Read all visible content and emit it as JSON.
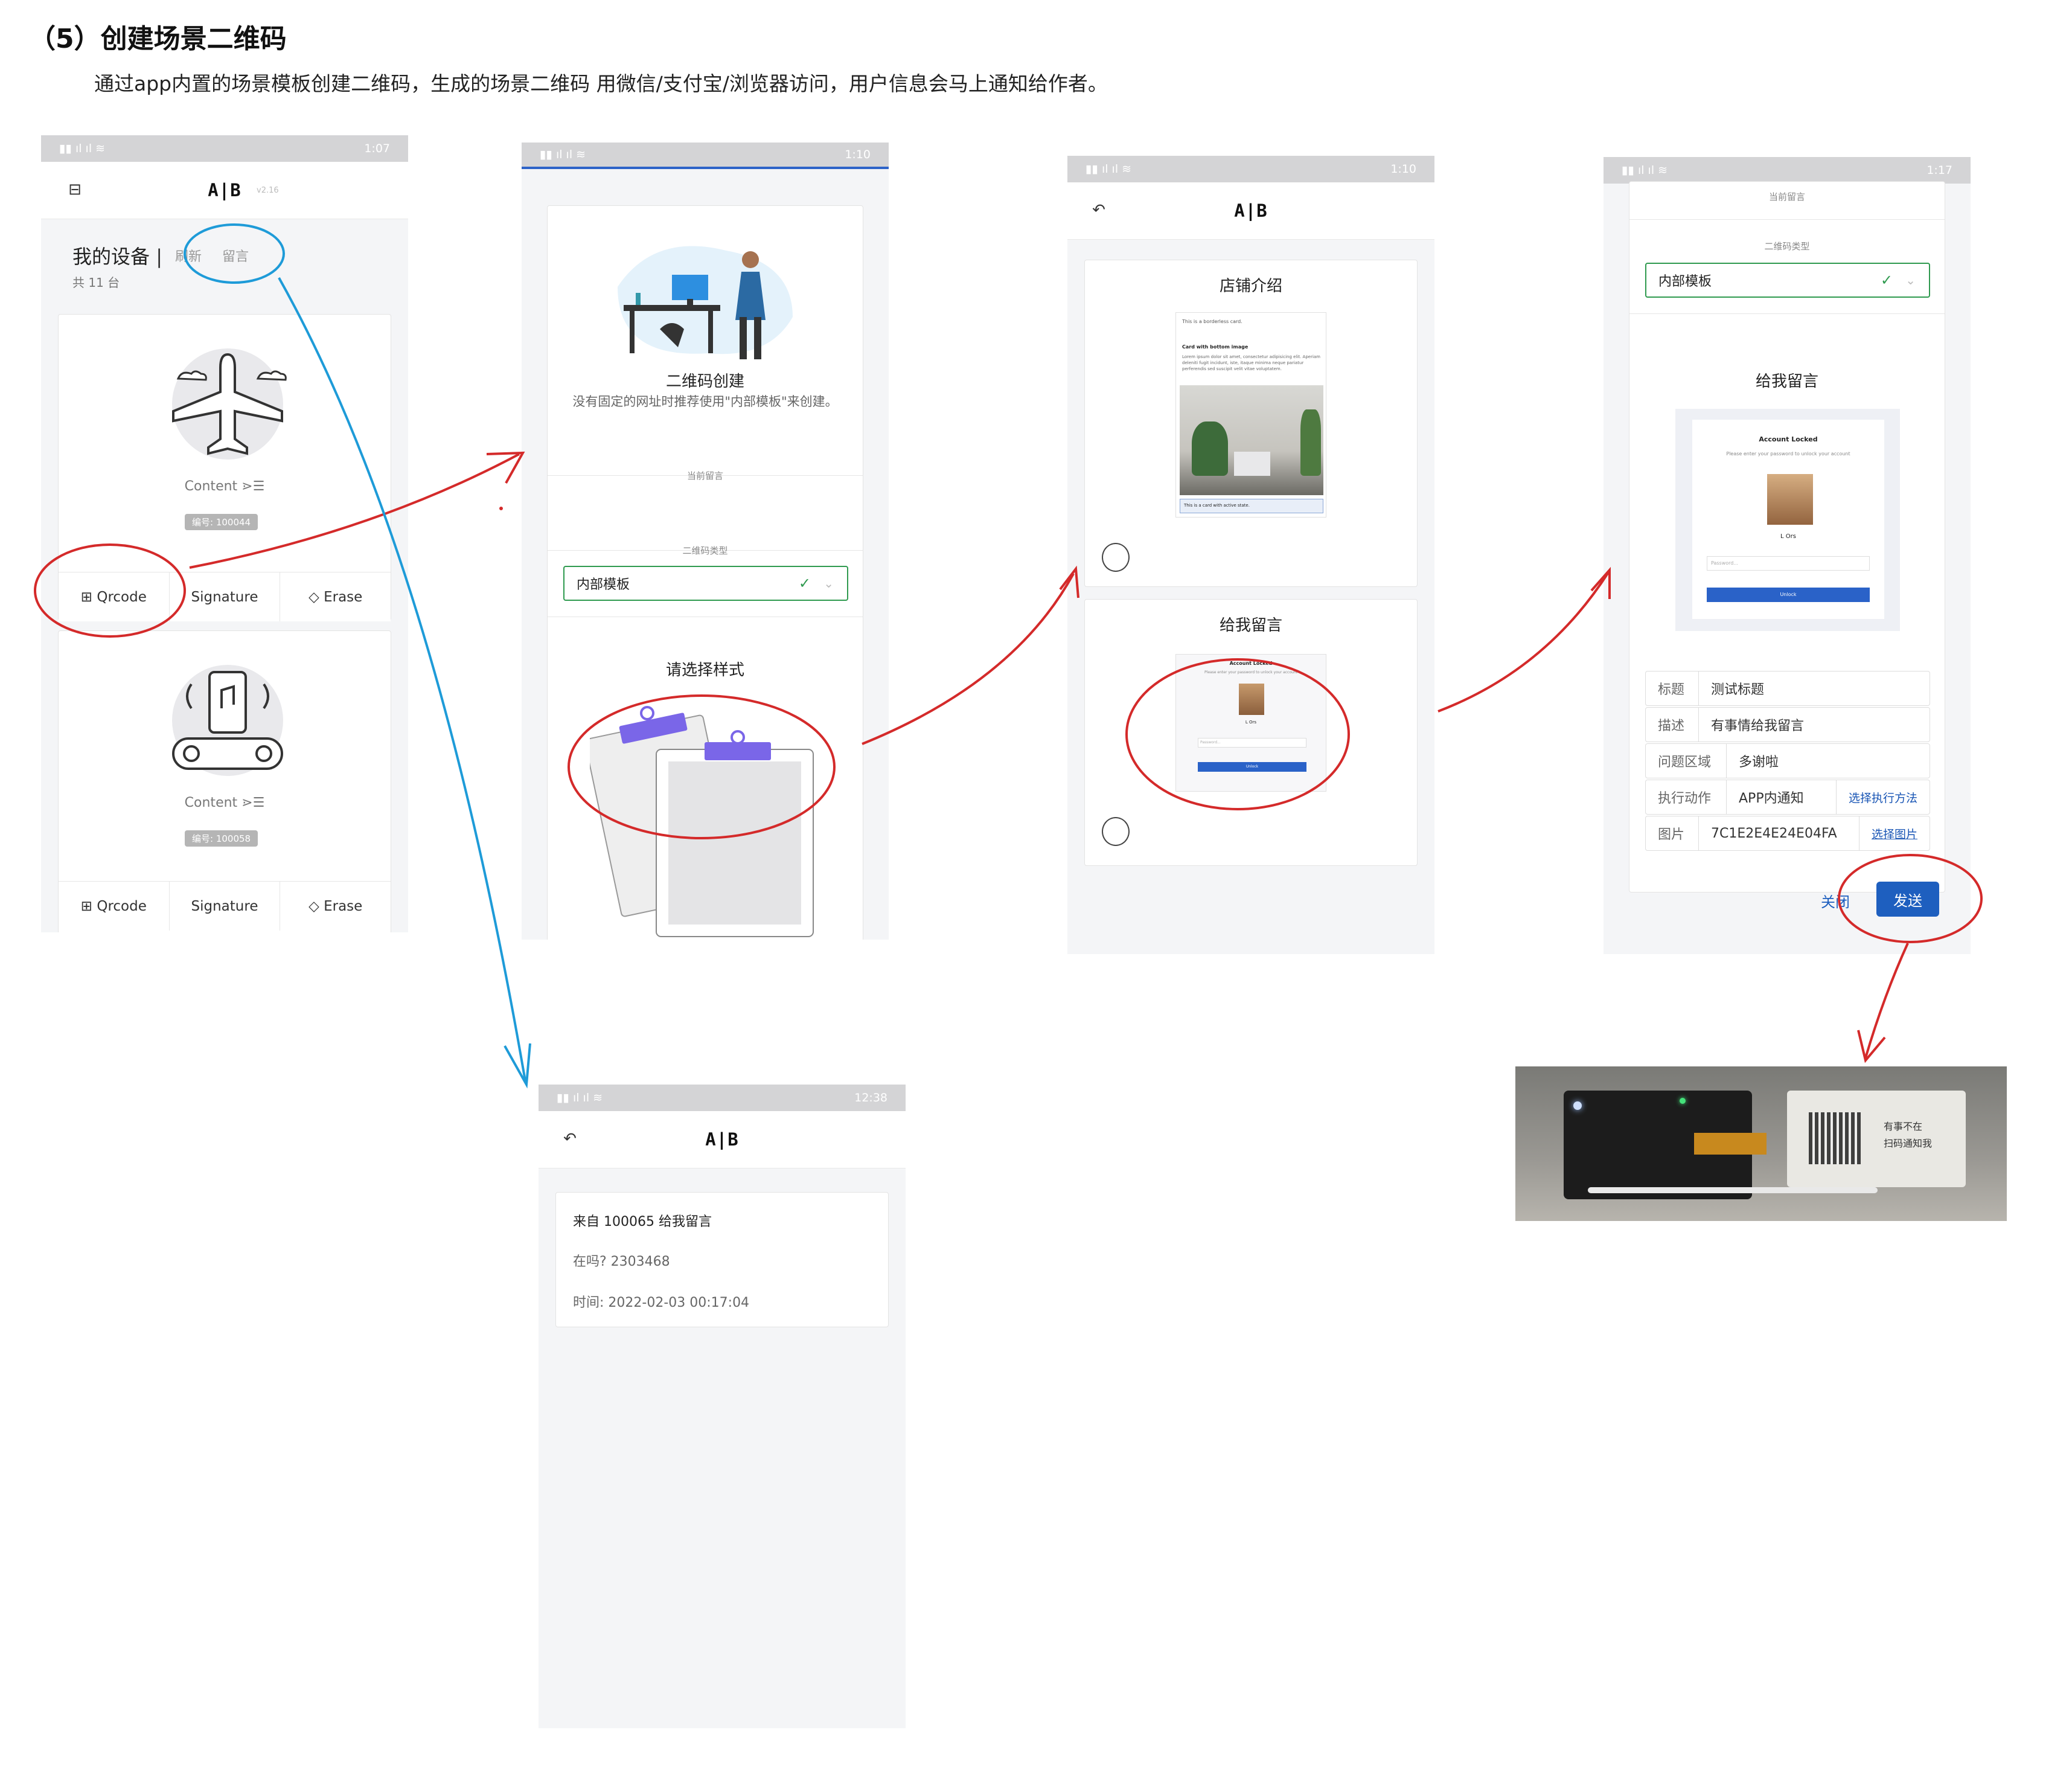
{
  "heading": "（5）创建场景二维码",
  "description": "通过app内置的场景模板创建二维码，生成的场景二维码 用微信/支付宝/浏览器访问，用户信息会马上通知给作者。",
  "logo": "A|B",
  "screen1": {
    "status_time": "1:07",
    "version": "v2.16",
    "title": "我的设备",
    "refresh": "刷新",
    "message": "留言",
    "count": "共 11 台",
    "devices": [
      {
        "content": "Content",
        "id": "编号: 100044"
      },
      {
        "content": "Content",
        "id": "编号: 100058"
      }
    ],
    "actions": {
      "qrcode": "Qrcode",
      "signature": "Signature",
      "erase": "Erase"
    }
  },
  "screen2": {
    "status_time": "1:10",
    "title": "二维码创建",
    "hint": "没有固定的网址时推荐使用\"内部模板\"来创建。",
    "current": "当前留言",
    "type_label": "二维码类型",
    "type_value": "内部模板",
    "choose_style": "请选择样式"
  },
  "screen3": {
    "status_time": "1:10",
    "shop_intro": "店铺介绍",
    "leave_msg": "给我留言",
    "mini_card": {
      "line1": "This is a borderless card.",
      "title": "Card with bottom image",
      "body": "Lorem ipsum dolor sit amet, consectetur adipisicing elit. Aperiam deleniti fugit incidunt, iste, itaque minima neque pariatur perferendis sed suscipit velit vitae voluptatem.",
      "footer": "This is a card with active state."
    },
    "locked": {
      "title": "Account Locked",
      "sub": "Please enter your password to unlock your account",
      "name": "L Ors",
      "placeholder": "Password...",
      "unlock": "Unlock"
    }
  },
  "screen4": {
    "status_time": "1:17",
    "current": "当前留言",
    "type_label": "二维码类型",
    "type_value": "内部模板",
    "leave_msg": "给我留言",
    "locked": {
      "title": "Account Locked",
      "sub": "Please enter your password to unlock your account",
      "name": "L Ors",
      "placeholder": "Password...",
      "unlock": "Unlock"
    },
    "fields": [
      {
        "k": "标题",
        "v": "测试标题"
      },
      {
        "k": "描述",
        "v": "有事情给我留言"
      },
      {
        "k": "问题区域",
        "v": "多谢啦"
      },
      {
        "k": "执行动作",
        "v": "APP内通知",
        "a": "选择执行方法"
      },
      {
        "k": "图片",
        "v": "7C1E2E4E24E04FA",
        "a": "选择图片"
      }
    ],
    "close": "关闭",
    "send": "发送"
  },
  "screen5": {
    "status_time": "12:38",
    "from": "来自 100065 给我留言",
    "msg": "在吗? 2303468",
    "time": "时间: 2022-02-03 00:17:04"
  },
  "eink": {
    "line1": "有事不在",
    "line2": "扫码通知我"
  },
  "colors": {
    "annotation_red": "#d42a2a",
    "annotation_blue": "#1e9bd8",
    "primary": "#1e5fbf",
    "success": "#2f9a4f",
    "accent_purple": "#7a66e8"
  }
}
